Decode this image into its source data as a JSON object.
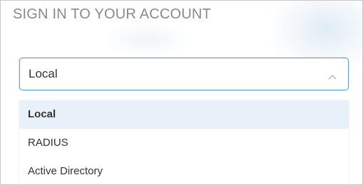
{
  "header": {
    "title": "SIGN IN TO YOUR ACCOUNT"
  },
  "auth_select": {
    "selected_value": "Local",
    "icon": "chevron-up-icon",
    "options": [
      {
        "label": "Local",
        "selected": true
      },
      {
        "label": "RADIUS",
        "selected": false
      },
      {
        "label": "Active Directory",
        "selected": false
      }
    ]
  },
  "colors": {
    "focus_border": "#6aa3d6",
    "selected_option_bg": "#e8f1f9",
    "title_text": "#8a8a8a",
    "body_text": "#333333"
  }
}
